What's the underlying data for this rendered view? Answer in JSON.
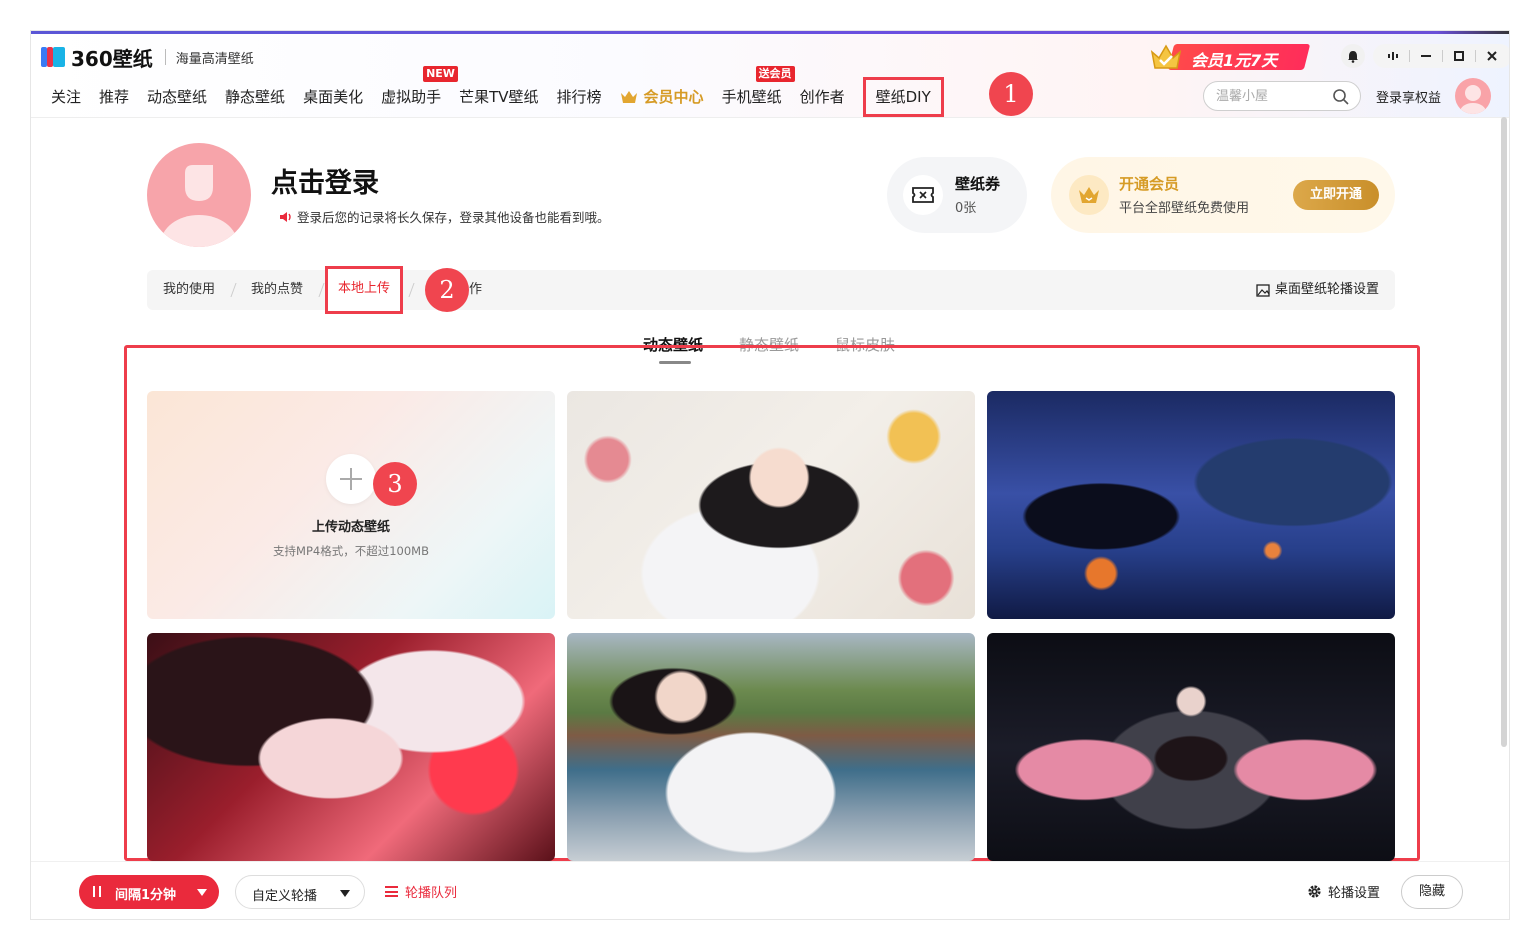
{
  "app": {
    "logo_text": "360壁纸",
    "subtitle": "海量高清壁纸",
    "promo": "会员1元7天"
  },
  "nav": {
    "items": [
      {
        "label": "关注"
      },
      {
        "label": "推荐"
      },
      {
        "label": "动态壁纸"
      },
      {
        "label": "静态壁纸"
      },
      {
        "label": "桌面美化"
      },
      {
        "label": "虚拟助手",
        "badge": "NEW"
      },
      {
        "label": "芒果TV壁纸"
      },
      {
        "label": "排行榜"
      },
      {
        "label": "会员中心"
      },
      {
        "label": "手机壁纸",
        "badge": "送会员"
      },
      {
        "label": "创作者"
      },
      {
        "label": "壁纸DIY"
      }
    ]
  },
  "search": {
    "placeholder": "温馨小屋"
  },
  "header_right": {
    "login_label": "登录享权益"
  },
  "profile": {
    "title": "点击登录",
    "notice": "登录后您的记录将长久保存，登录其他设备也能看到哦。",
    "coupon_title": "壁纸券",
    "coupon_count": "0张",
    "vip_title": "开通会员",
    "vip_desc": "平台全部壁纸免费使用",
    "vip_button": "立即开通"
  },
  "tabs": {
    "items": [
      "我的使用",
      "我的点赞",
      "本地上传"
    ],
    "partial_tail": "作",
    "active_index": 2,
    "carousel_setting": "桌面壁纸轮播设置"
  },
  "subtabs": {
    "items": [
      "动态壁纸",
      "静态壁纸",
      "鼠标皮肤"
    ],
    "active_index": 0
  },
  "upload": {
    "title": "上传动态壁纸",
    "desc": "支持MP4格式，不超过100MB"
  },
  "markers": [
    "1",
    "2",
    "3"
  ],
  "bottom": {
    "interval": "间隔1分钟",
    "custom": "自定义轮播",
    "queue": "轮播队列",
    "settings": "轮播设置",
    "hide": "隐藏"
  },
  "colors": {
    "accent_red": "#ea2a3c",
    "annotation_red": "#ee3d4b",
    "vip_gold": "#d69b25"
  }
}
